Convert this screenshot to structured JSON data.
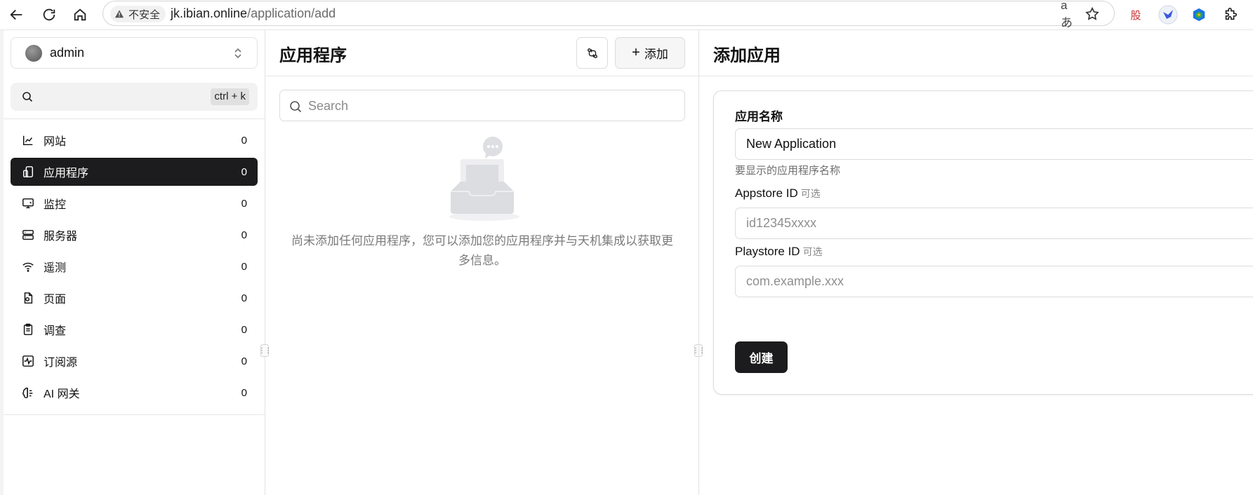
{
  "browser": {
    "security_label": "不安全",
    "url_host": "jk.ibian.online",
    "url_path": "/application/add",
    "translate_glyph": "aあ",
    "ext_text_glyph": "股"
  },
  "sidebar": {
    "account_name": "admin",
    "search_shortcut": "ctrl + k",
    "items": [
      {
        "label": "网站",
        "count": "0",
        "icon": "chart-line-icon",
        "active": false
      },
      {
        "label": "应用程序",
        "count": "0",
        "icon": "mobile-app-icon",
        "active": true
      },
      {
        "label": "监控",
        "count": "0",
        "icon": "monitor-icon",
        "active": false
      },
      {
        "label": "服务器",
        "count": "0",
        "icon": "server-icon",
        "active": false
      },
      {
        "label": "遥测",
        "count": "0",
        "icon": "wifi-icon",
        "active": false
      },
      {
        "label": "页面",
        "count": "0",
        "icon": "file-page-icon",
        "active": false
      },
      {
        "label": "调查",
        "count": "0",
        "icon": "clipboard-icon",
        "active": false
      },
      {
        "label": "订阅源",
        "count": "0",
        "icon": "activity-icon",
        "active": false
      },
      {
        "label": "AI 网关",
        "count": "0",
        "icon": "brain-icon",
        "active": false
      }
    ]
  },
  "middle": {
    "title": "应用程序",
    "add_label": "添加",
    "search_placeholder": "Search",
    "empty_text": "尚未添加任何应用程序，您可以添加您的应用程序并与天机集成以获取更多信息。"
  },
  "form": {
    "title": "添加应用",
    "name_label": "应用名称",
    "name_value": "New Application",
    "name_help": "要显示的应用程序名称",
    "appstore_label": "Appstore ID",
    "appstore_optional": "可选",
    "appstore_placeholder": "id12345xxxx",
    "playstore_label": "Playstore ID",
    "playstore_optional": "可选",
    "playstore_placeholder": "com.example.xxx",
    "submit_label": "创建"
  },
  "colors": {
    "active_bg": "#1c1c1e",
    "border": "#dcdcdc",
    "muted_text": "#7a7a7a"
  }
}
